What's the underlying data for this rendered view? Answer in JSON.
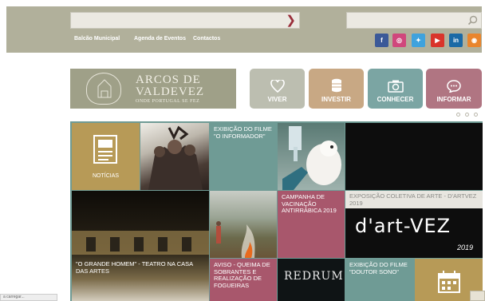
{
  "header": {
    "nav": [
      "Balcão Municipal",
      "Agenda de Eventos",
      "Contactos"
    ],
    "social": [
      {
        "icon": "facebook-icon",
        "glyph": "f",
        "color": "#3b5998"
      },
      {
        "icon": "instagram-icon",
        "glyph": "◎",
        "color": "#d0477c"
      },
      {
        "icon": "twitter-icon",
        "glyph": "✦",
        "color": "#3fa2dd"
      },
      {
        "icon": "youtube-icon",
        "glyph": "▶",
        "color": "#d9342b"
      },
      {
        "icon": "linkedin-icon",
        "glyph": "in",
        "color": "#1b6aa6"
      },
      {
        "icon": "rss-icon",
        "glyph": "◉",
        "color": "#e9852d"
      }
    ]
  },
  "logo": {
    "line1": "ARCOS DE",
    "line2": "VALDEVEZ",
    "tagline": "ONDE PORTUGAL SE FEZ"
  },
  "quick_links": [
    {
      "label": "VIVER",
      "icon": "heart-icon",
      "color": "#bcbeb0"
    },
    {
      "label": "INVESTIR",
      "icon": "coins-icon",
      "color": "#c8a884"
    },
    {
      "label": "CONHECER",
      "icon": "camera-icon",
      "color": "#7ba5a3"
    },
    {
      "label": "INFORMAR",
      "icon": "chat-icon",
      "color": "#b07582"
    }
  ],
  "news_grid": {
    "noticias_label": "NOTÍCIAS",
    "captions": {
      "informador": "EXIBIÇÃO DO FILME \"O INFORMADOR\"",
      "vacinacao": "CAMPANHA DE VACINAÇÃO ANTIRRÁBICA 2019",
      "exposicao": "EXPOSIÇÃO COLETIVA DE ARTE - D'ARTVEZ 2019",
      "grande_homem": "\"O GRANDE HOMEM\" - TEATRO NA CASA DAS ARTES",
      "aviso": "AVISO - QUEIMA DE SOBRANTES E REALIZAÇÃO DE FOGUEIRAS",
      "doutor_sono": "EXIBIÇÃO DO FILME \"DOUTOR SONO\""
    },
    "artvez_logo": "d'art-VEZ",
    "artvez_year": "2019",
    "redrum": "REDRUM"
  },
  "footer": {
    "status": "a carregar..."
  }
}
